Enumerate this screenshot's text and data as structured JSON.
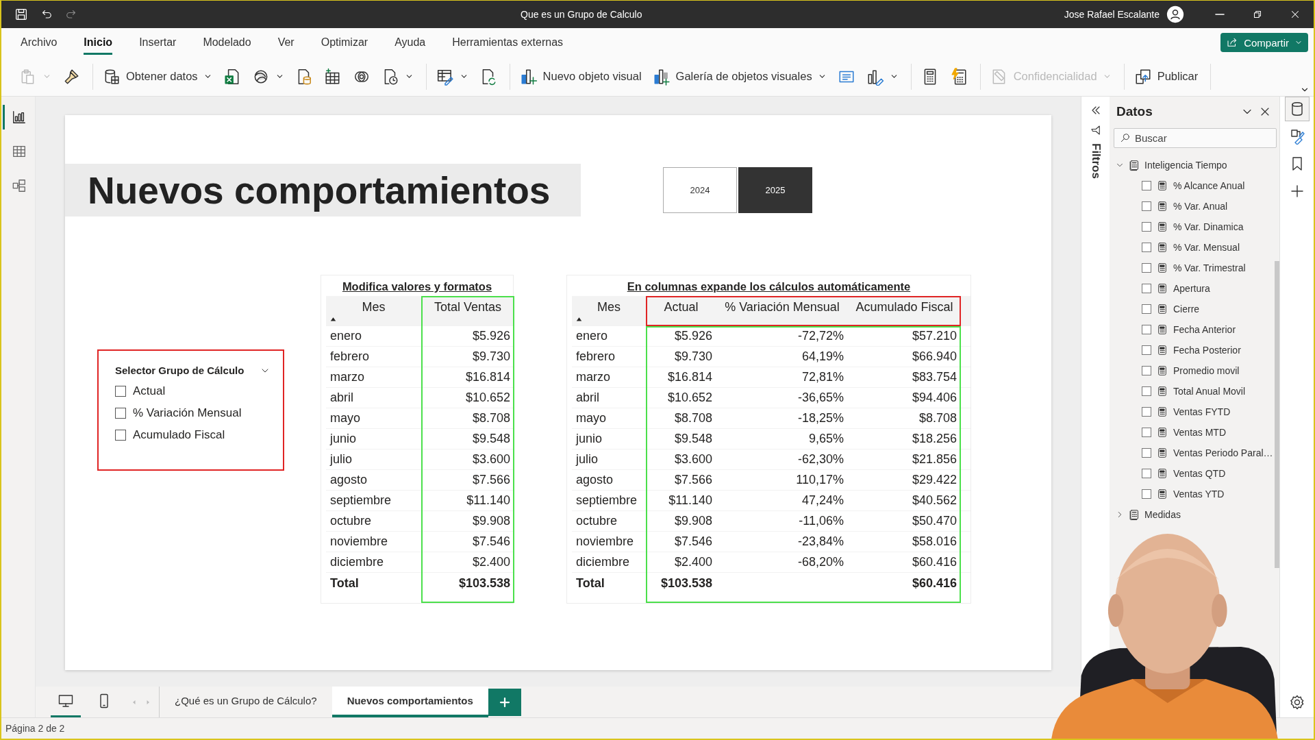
{
  "window": {
    "title": "Que es un Grupo de Calculo",
    "user": "Jose Rafael Escalante"
  },
  "menu_tabs": [
    {
      "label": "Archivo",
      "selected": false
    },
    {
      "label": "Inicio",
      "selected": true
    },
    {
      "label": "Insertar",
      "selected": false
    },
    {
      "label": "Modelado",
      "selected": false
    },
    {
      "label": "Ver",
      "selected": false
    },
    {
      "label": "Optimizar",
      "selected": false
    },
    {
      "label": "Ayuda",
      "selected": false
    },
    {
      "label": "Herramientas externas",
      "selected": false
    }
  ],
  "share_button": "Compartir",
  "ribbon": [
    {
      "label": "Obtener datos",
      "disabled": false
    },
    {
      "label": "Nuevo objeto visual",
      "disabled": false
    },
    {
      "label": "Galería de objetos visuales",
      "disabled": false
    },
    {
      "label": "Confidencialidad",
      "disabled": true
    },
    {
      "label": "Publicar",
      "disabled": false
    }
  ],
  "left_rail": [
    {
      "kind": "report",
      "selected": true
    },
    {
      "kind": "table",
      "selected": false
    },
    {
      "kind": "model",
      "selected": false
    }
  ],
  "report": {
    "title": "Nuevos comportamientos",
    "years": [
      {
        "label": "2024",
        "selected": false
      },
      {
        "label": "2025",
        "selected": true
      }
    ],
    "slicer": {
      "title": "Selector Grupo de Cálculo",
      "options": [
        {
          "label": "Actual",
          "checked": false
        },
        {
          "label": "% Variación Mensual",
          "checked": false
        },
        {
          "label": "Acumulado Fiscal",
          "checked": false
        }
      ]
    },
    "table_1": {
      "title": "Modifica valores y formatos",
      "columns": [
        "Mes",
        "Total Ventas"
      ],
      "rows": [
        [
          "enero",
          "$5.926"
        ],
        [
          "febrero",
          "$9.730"
        ],
        [
          "marzo",
          "$16.814"
        ],
        [
          "abril",
          "$10.652"
        ],
        [
          "mayo",
          "$8.708"
        ],
        [
          "junio",
          "$9.548"
        ],
        [
          "julio",
          "$3.600"
        ],
        [
          "agosto",
          "$7.566"
        ],
        [
          "septiembre",
          "$11.140"
        ],
        [
          "octubre",
          "$9.908"
        ],
        [
          "noviembre",
          "$7.546"
        ],
        [
          "diciembre",
          "$2.400"
        ]
      ],
      "total": [
        {
          "text": "Total"
        },
        {
          "text": "$103.538"
        }
      ]
    },
    "table_2": {
      "title": "En columnas expande los cálculos automáticamente",
      "columns": [
        "Mes",
        "Actual",
        "% Variación Mensual",
        "Acumulado Fiscal"
      ],
      "rows": [
        [
          "enero",
          "$5.926",
          "-72,72%",
          "$57.210"
        ],
        [
          "febrero",
          "$9.730",
          "64,19%",
          "$66.940"
        ],
        [
          "marzo",
          "$16.814",
          "72,81%",
          "$83.754"
        ],
        [
          "abril",
          "$10.652",
          "-36,65%",
          "$94.406"
        ],
        [
          "mayo",
          "$8.708",
          "-18,25%",
          "$8.708"
        ],
        [
          "junio",
          "$9.548",
          "9,65%",
          "$18.256"
        ],
        [
          "julio",
          "$3.600",
          "-62,30%",
          "$21.856"
        ],
        [
          "agosto",
          "$7.566",
          "110,17%",
          "$29.422"
        ],
        [
          "septiembre",
          "$11.140",
          "47,24%",
          "$40.562"
        ],
        [
          "octubre",
          "$9.908",
          "-11,06%",
          "$50.470"
        ],
        [
          "noviembre",
          "$7.546",
          "-23,84%",
          "$58.016"
        ],
        [
          "diciembre",
          "$2.400",
          "-68,20%",
          "$60.416"
        ]
      ],
      "total": [
        {
          "text": "Total"
        },
        {
          "text": "$103.538"
        },
        {
          "blank": true
        },
        {
          "text": "$60.416"
        }
      ]
    }
  },
  "filters_pane": {
    "label": "Filtros"
  },
  "data_pane": {
    "title": "Datos",
    "search": {
      "placeholder": "Buscar"
    },
    "tree": [
      {
        "label": "Inteligencia Tiempo",
        "expanded": true,
        "children": [
          {
            "label": "% Alcance Anual",
            "checked": false
          },
          {
            "label": "% Var. Anual",
            "checked": false
          },
          {
            "label": "% Var. Dinamica",
            "checked": false
          },
          {
            "label": "% Var. Mensual",
            "checked": false
          },
          {
            "label": "% Var. Trimestral",
            "checked": false
          },
          {
            "label": "Apertura",
            "checked": false
          },
          {
            "label": "Cierre",
            "checked": false
          },
          {
            "label": "Fecha Anterior",
            "checked": false
          },
          {
            "label": "Fecha Posterior",
            "checked": false
          },
          {
            "label": "Promedio movil",
            "checked": false
          },
          {
            "label": "Total Anual Movil",
            "checked": false
          },
          {
            "label": "Ventas FYTD",
            "checked": false
          },
          {
            "label": "Ventas MTD",
            "checked": false
          },
          {
            "label": "Ventas Periodo Paral…",
            "checked": false
          },
          {
            "label": "Ventas QTD",
            "checked": false
          },
          {
            "label": "Ventas YTD",
            "checked": false
          }
        ]
      },
      {
        "label": "Medidas",
        "expanded": false
      }
    ]
  },
  "right_rail": [
    {
      "kind": "data",
      "selected": true
    },
    {
      "kind": "format",
      "selected": false
    },
    {
      "kind": "bookmark",
      "selected": false
    },
    {
      "kind": "add",
      "selected": false
    },
    {
      "kind": "settings",
      "selected": false
    }
  ],
  "view_modes": [
    {
      "kind": "desktop",
      "selected": true
    },
    {
      "kind": "mobile",
      "selected": false
    }
  ],
  "page_tabs": [
    {
      "label": "¿Qué es un Grupo de Cálculo?",
      "selected": false
    },
    {
      "label": "Nuevos comportamientos",
      "selected": true
    }
  ],
  "status_bar": "Página 2 de 2"
}
